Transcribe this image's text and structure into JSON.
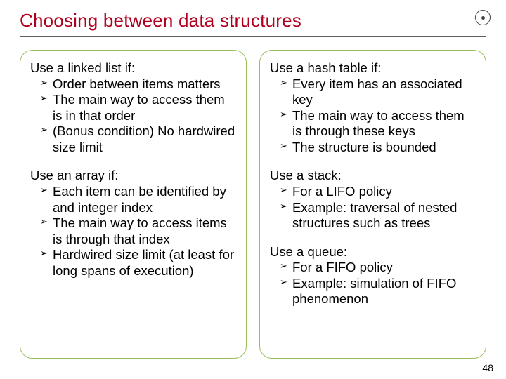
{
  "title": "Choosing between data structures",
  "page_number": "48",
  "left": {
    "sections": [
      {
        "heading": "Use a linked list if:",
        "items": [
          "Order between items matters",
          "The main way to access them is in that order",
          "(Bonus condition) No hardwired size limit"
        ]
      },
      {
        "heading": "Use an array if:",
        "items": [
          "Each item can be identified by and integer index",
          "The main way to access items is through that index",
          "Hardwired size limit (at least for long spans of execution)"
        ]
      }
    ]
  },
  "right": {
    "sections": [
      {
        "heading": "Use a hash table if:",
        "items": [
          "Every item has an associated key",
          "The main way to access them is through these keys",
          "The structure is bounded"
        ]
      },
      {
        "heading": "Use a stack:",
        "items": [
          "For a LIFO policy",
          "Example: traversal of nested structures such as trees"
        ]
      },
      {
        "heading": "Use a queue:",
        "items": [
          "For a FIFO policy",
          "Example: simulation of FIFO phenomenon"
        ]
      }
    ]
  }
}
